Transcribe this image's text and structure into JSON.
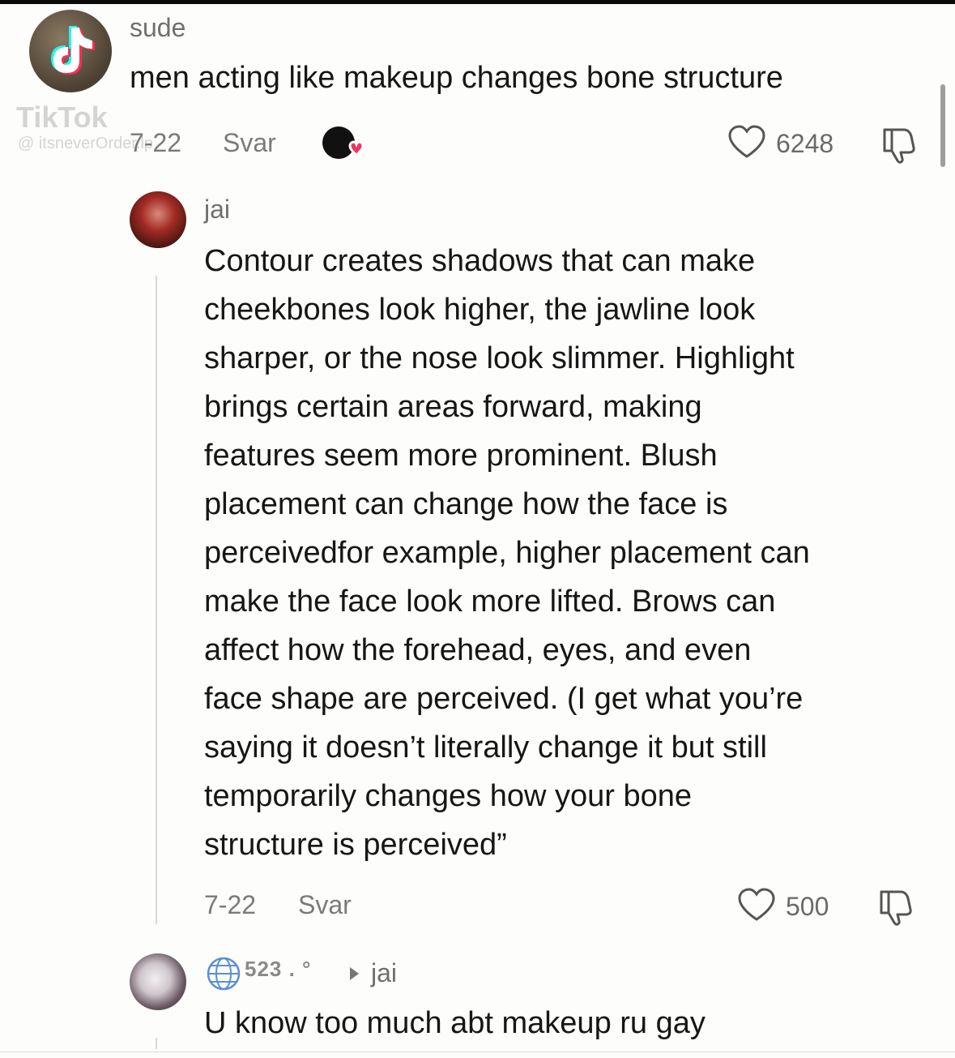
{
  "comments": [
    {
      "username": "sude",
      "text": "men acting like makeup changes bone structure",
      "date": "7-22",
      "reply_label": "Svar",
      "likes": "6248"
    },
    {
      "username": "jai",
      "text_lines": [
        "Contour creates shadows that can make",
        "cheekbones look higher, the jawline look",
        "sharper, or the nose look slimmer. Highlight",
        "brings certain areas forward, making",
        "features seem more prominent. Blush",
        "placement can change how the face is",
        "perceivedfor example, higher placement can",
        "make the face look more lifted. Brows can",
        "affect how the forehead, eyes, and even",
        "face shape are perceived. (I get what you’re",
        "saying it doesn’t literally change it but still",
        "temporarily changes how your bone",
        "structure is perceived”"
      ],
      "date": "7-22",
      "reply_label": "Svar",
      "likes": "500"
    },
    {
      "username": "523 . °",
      "reply_to": "jai",
      "text": "U know too much abt makeup ru gay"
    }
  ],
  "watermark": {
    "brand": "TikTok",
    "handle": "@ itsneverOrder.lp"
  },
  "icons": {
    "like": "heart-outline-icon",
    "dislike": "thumbs-down-icon",
    "creator_liked": "creator-heart-badge-icon",
    "globe": "globe-icon",
    "reply_arrow": "triangle-right-icon"
  },
  "colors": {
    "text": "#161616",
    "muted": "#7a7a7a",
    "heart_badge": "#f0345e"
  }
}
